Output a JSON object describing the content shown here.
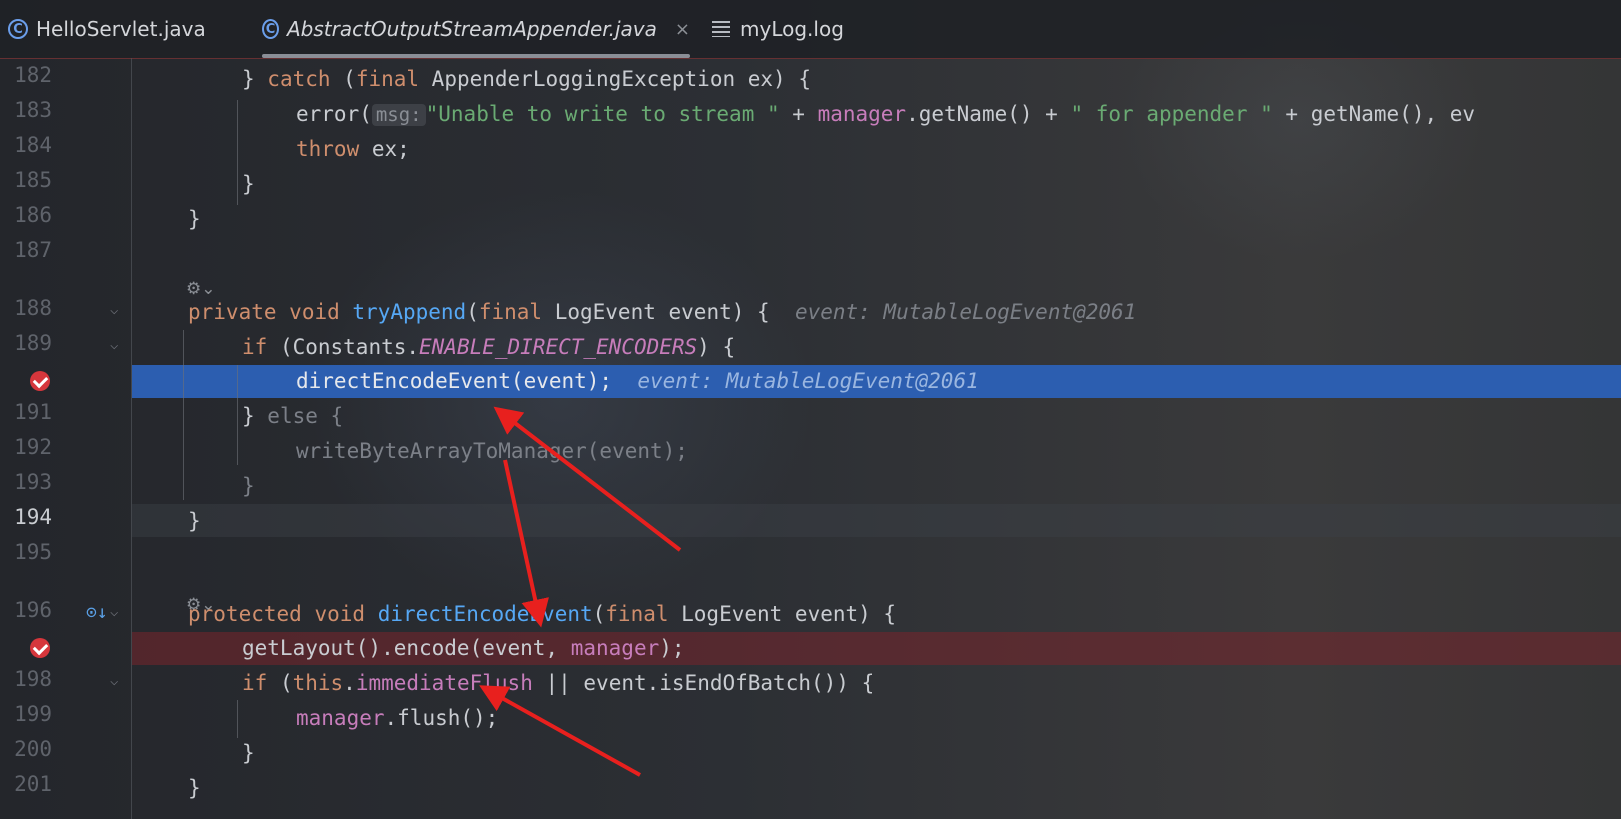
{
  "tabs": [
    {
      "label": "HelloServlet.java",
      "icon": "class-icon"
    },
    {
      "label": "AbstractOutputStreamAppender.java",
      "icon": "class-icon",
      "active": true,
      "close": "×"
    },
    {
      "label": "myLog.log",
      "icon": "text-file-icon"
    }
  ],
  "line_numbers": [
    "182",
    "183",
    "184",
    "185",
    "186",
    "187",
    "188",
    "189",
    "191",
    "192",
    "193",
    "194",
    "195",
    "196",
    "198",
    "199",
    "200",
    "201"
  ],
  "code": {
    "l182": {
      "a": "} ",
      "b": "catch",
      "c": " (",
      "d": "final",
      "e": " AppenderLoggingException ex) {"
    },
    "l183": {
      "a": "error(",
      "param": "msg:",
      "s1": "\"Unable to write to stream \"",
      "b": " + ",
      "f": "manager",
      "c": ".getName() + ",
      "s2": "\" for appender \"",
      "d": " + getName(), ev"
    },
    "l184": {
      "a": "throw",
      "b": " ex;"
    },
    "l185": "}",
    "l186": "}",
    "l188": {
      "a": "private",
      "b": " ",
      "c": "void",
      "d": " ",
      "e": "tryAppend",
      "f": "(",
      "g": "final",
      "h": " LogEvent event) {",
      "hint": "event: MutableLogEvent@2061"
    },
    "l189": {
      "a": "if",
      "b": " (Constants.",
      "c": "ENABLE_DIRECT_ENCODERS",
      "d": ") {"
    },
    "l190": {
      "a": "directEncodeEvent(event);",
      "hint": "event: MutableLogEvent@2061"
    },
    "l191": {
      "a": "} ",
      "b": "else {"
    },
    "l192": "writeByteArrayToManager(event);",
    "l193": "}",
    "l194": "}",
    "l196": {
      "a": "protected",
      "b": " ",
      "c": "void",
      "d": " ",
      "e": "directEncodeEvent",
      "f": "(",
      "g": "final",
      "h": " LogEvent event) {"
    },
    "l197": {
      "a": "getLayout().encode(event, ",
      "f": "manager",
      "b": ");"
    },
    "l198": {
      "a": "if",
      "b": " (",
      "c": "this",
      "d": ".",
      "e": "immediateFlush",
      "g": " || event.isEndOfBatch()) {"
    },
    "l199": {
      "f": "manager",
      "a": ".flush();"
    },
    "l200": "}",
    "l201": "}"
  },
  "colors": {
    "breakpoint": "#d6363c",
    "execution_line": "#2c5eb0",
    "annotation_arrow": "#e8201e"
  }
}
